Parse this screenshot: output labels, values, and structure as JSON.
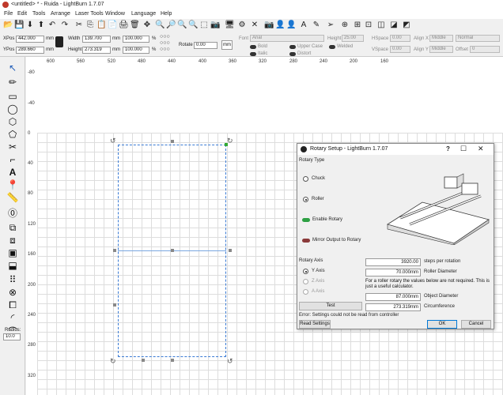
{
  "titlebar": {
    "title": "<untitled> * - Ruida - LightBurn 1.7.07"
  },
  "menu": [
    "File",
    "Edit",
    "Tools",
    "Arrange",
    "Laser Tools",
    "Window",
    "Language",
    "Help"
  ],
  "props": {
    "xpos_label": "XPos",
    "xpos": "442.000",
    "ypos_label": "YPos",
    "ypos": "289.660",
    "unit": "mm",
    "width_label": "Width",
    "width": "139.700",
    "height_label": "Height",
    "height": "273.319",
    "scale_w": "100.000",
    "scale_h": "100.000",
    "pct": "%",
    "rotate_label": "Rotate",
    "rotate": "0.00",
    "mm_btn": "mm",
    "font_label": "Font",
    "font": "Arial",
    "fheight_label": "Height",
    "fheight": "25.00",
    "hspace_label": "HSpace",
    "hspace": "0.00",
    "vspace_label": "VSpace",
    "vspace": "0.00",
    "alignx_label": "Align X",
    "alignx": "Middle",
    "aligny_label": "Align Y",
    "aligny": "Middle",
    "normal": "Normal",
    "offset_label": "Offset",
    "offset": "0",
    "bold": "Bold",
    "italic": "Italic",
    "upper": "Upper Case",
    "distort": "Distort",
    "welded": "Welded"
  },
  "ruler_top": [
    "600",
    "560",
    "520",
    "480",
    "440",
    "400",
    "360",
    "320",
    "280",
    "240",
    "200",
    "160"
  ],
  "ruler_left_upper": [
    "-80",
    "-40",
    "0"
  ],
  "ruler_left": [
    "40",
    "80",
    "120",
    "160",
    "200",
    "240",
    "280",
    "320"
  ],
  "radius": {
    "label": "Radius:",
    "value": "10.0"
  },
  "dialog": {
    "title": "Rotary Setup - LightBurn 1.7.07",
    "rotary_type": "Rotary Type",
    "chuck": "Chuck",
    "roller": "Roller",
    "enable_rotary": "Enable Rotary",
    "mirror_output": "Mirror Output to Rotary",
    "rotary_axis": "Rotary Axis",
    "y_axis": "Y Axis",
    "z_axis": "Z Axis",
    "a_axis": "A Axis",
    "steps": "3920.00",
    "steps_label": "steps per rotation",
    "roller_diam": "70.000mm",
    "roller_diam_label": "Roller Diameter",
    "note": "For a roller rotary the values below are not required. This is just a useful calculator.",
    "obj_diam": "87.000mm",
    "obj_diam_label": "Object Diameter",
    "test": "Test",
    "circ": "273.319mm",
    "circ_label": "Circumference",
    "error": "Error: Settings could not be read from controller",
    "read_settings": "Read Settings",
    "ok": "OK",
    "cancel": "Cancel"
  }
}
